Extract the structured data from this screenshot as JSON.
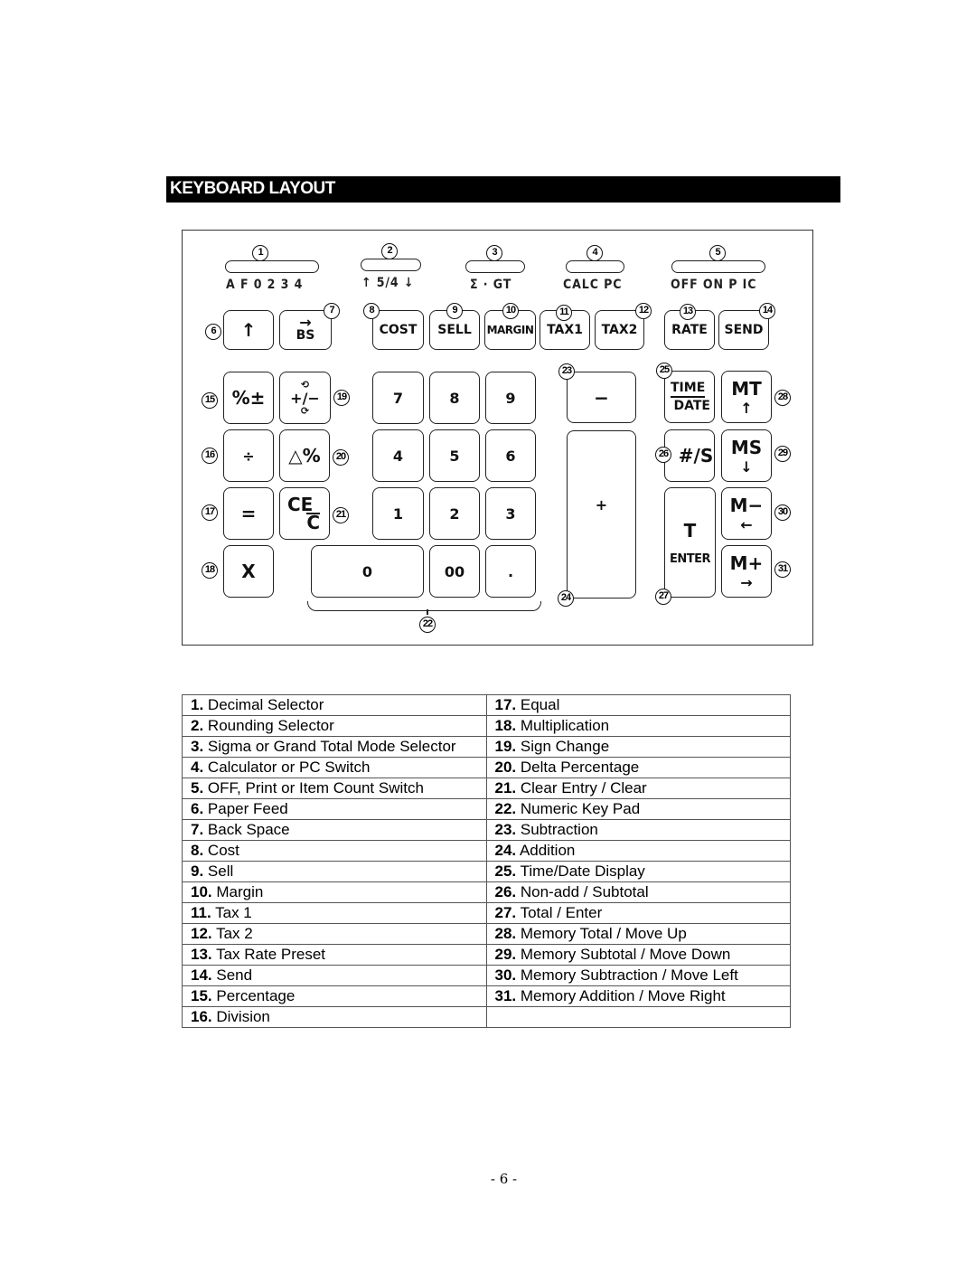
{
  "header": {
    "title": "KEYBOARD LAYOUT"
  },
  "diagram": {
    "switches": [
      {
        "num": "1",
        "label": "A F 0 2 3 4"
      },
      {
        "num": "2",
        "label": "↑ 5/4 ↓"
      },
      {
        "num": "3",
        "label": "Σ  ·  GT"
      },
      {
        "num": "4",
        "label": "CALC PC"
      },
      {
        "num": "5",
        "label": "OFF ON P IC"
      }
    ],
    "keys": {
      "paper_feed": {
        "num": "6",
        "label": "↑"
      },
      "backspace": {
        "num": "7",
        "arrow": "→",
        "label": "BS"
      },
      "cost": {
        "num": "8",
        "label": "COST"
      },
      "sell": {
        "num": "9",
        "label": "SELL"
      },
      "margin": {
        "num": "10",
        "label": "MARGIN"
      },
      "tax1": {
        "num": "11",
        "label": "TAX1"
      },
      "tax2": {
        "num": "12",
        "label": "TAX2"
      },
      "rate": {
        "num": "13",
        "label": "RATE"
      },
      "send": {
        "num": "14",
        "label": "SEND"
      },
      "percent": {
        "num": "15",
        "label": "%±"
      },
      "divide": {
        "num": "16",
        "label": "÷"
      },
      "equal": {
        "num": "17",
        "label": "="
      },
      "multiply": {
        "num": "18",
        "label": "X"
      },
      "sign_change": {
        "num": "19",
        "label": "+/−"
      },
      "delta_percent": {
        "num": "20",
        "label": "△%"
      },
      "clear": {
        "num": "21",
        "top": "CE",
        "bottom": "C"
      },
      "numpad": {
        "num": "22"
      },
      "subtract": {
        "num": "23",
        "label": "−"
      },
      "add": {
        "num": "24",
        "label": "+"
      },
      "time_date": {
        "num": "25",
        "top": "TIME",
        "bottom": "DATE"
      },
      "nonadd": {
        "num": "26",
        "label": "#/S"
      },
      "total": {
        "num": "27",
        "top": "T",
        "bottom": "ENTER"
      },
      "mt": {
        "num": "28",
        "label": "MT",
        "arrow": "↑"
      },
      "ms": {
        "num": "29",
        "label": "MS",
        "arrow": "↓"
      },
      "mminus": {
        "num": "30",
        "label": "M−",
        "arrow": "←"
      },
      "mplus": {
        "num": "31",
        "label": "M+",
        "arrow": "→"
      },
      "digits": [
        "7",
        "8",
        "9",
        "4",
        "5",
        "6",
        "1",
        "2",
        "3",
        "0",
        "00",
        "."
      ]
    }
  },
  "legend": {
    "left": [
      {
        "num": "1.",
        "text": "Decimal Selector"
      },
      {
        "num": "2.",
        "text": "Rounding Selector"
      },
      {
        "num": "3.",
        "text": "Sigma or Grand Total Mode Selector"
      },
      {
        "num": "4.",
        "text": "Calculator or PC Switch"
      },
      {
        "num": "5.",
        "text": "OFF, Print or Item Count Switch"
      },
      {
        "num": "6.",
        "text": "Paper Feed"
      },
      {
        "num": "7.",
        "text": "Back Space"
      },
      {
        "num": "8.",
        "text": "Cost"
      },
      {
        "num": "9.",
        "text": "Sell"
      },
      {
        "num": "10.",
        "text": "Margin"
      },
      {
        "num": "11.",
        "text": "Tax 1"
      },
      {
        "num": "12.",
        "text": "Tax 2"
      },
      {
        "num": "13.",
        "text": "Tax Rate Preset"
      },
      {
        "num": "14.",
        "text": "Send"
      },
      {
        "num": "15.",
        "text": "Percentage"
      },
      {
        "num": "16.",
        "text": "Division"
      }
    ],
    "right": [
      {
        "num": "17.",
        "text": "Equal"
      },
      {
        "num": "18.",
        "text": "Multiplication"
      },
      {
        "num": "19.",
        "text": "Sign Change"
      },
      {
        "num": "20.",
        "text": "Delta Percentage"
      },
      {
        "num": "21.",
        "text": "Clear Entry / Clear"
      },
      {
        "num": "22.",
        "text": "Numeric Key Pad"
      },
      {
        "num": "23.",
        "text": "Subtraction"
      },
      {
        "num": "24.",
        "text": "Addition"
      },
      {
        "num": "25.",
        "text": "Time/Date Display"
      },
      {
        "num": "26.",
        "text": "Non-add / Subtotal"
      },
      {
        "num": "27.",
        "text": "Total / Enter"
      },
      {
        "num": "28.",
        "text": "Memory Total / Move Up"
      },
      {
        "num": "29.",
        "text": "Memory Subtotal / Move Down"
      },
      {
        "num": "30.",
        "text": "Memory Subtraction / Move Left"
      },
      {
        "num": "31.",
        "text": "Memory Addition / Move Right"
      },
      {
        "num": "",
        "text": ""
      }
    ]
  },
  "footer": {
    "page": "- 6 -"
  }
}
